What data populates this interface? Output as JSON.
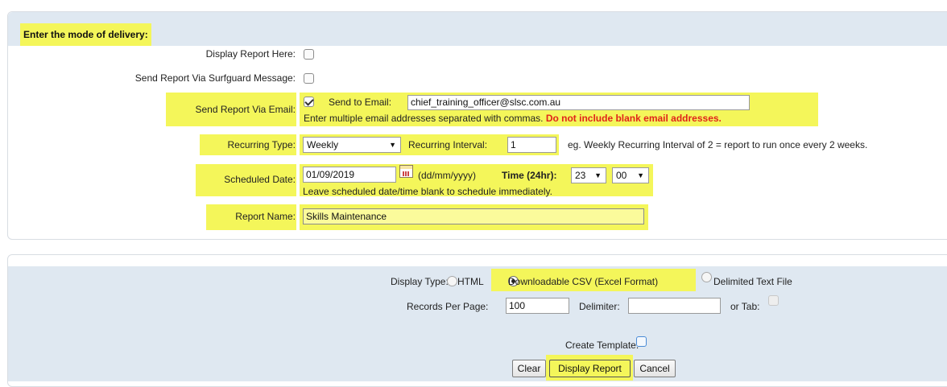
{
  "delivery": {
    "section_title": "Enter the mode of delivery:",
    "display_here_label": "Display Report Here:",
    "send_surfguard_label": "Send Report Via Surfguard Message:",
    "send_email_label": "Send Report Via Email:",
    "send_to_email_label": "Send to Email:",
    "email_value": "chief_training_officer@slsc.com.au",
    "email_note": "Enter multiple email addresses separated with commas.",
    "email_warning": "Do not include blank email addresses.",
    "recurring_type_label": "Recurring Type:",
    "recurring_type_value": "Weekly",
    "recurring_interval_label": "Recurring Interval:",
    "recurring_interval_value": "1",
    "recurring_note": "eg. Weekly Recurring Interval of 2 = report to run once every 2 weeks.",
    "scheduled_date_label": "Scheduled Date:",
    "scheduled_date_value": "01/09/2019",
    "date_format": "(dd/mm/yyyy)",
    "time_label": "Time (24hr):",
    "hour_value": "23",
    "minute_value": "00",
    "schedule_note": "Leave scheduled date/time blank to schedule immediately.",
    "report_name_label": "Report Name:",
    "report_name_value": "Skills Maintenance"
  },
  "output": {
    "display_type_label": "Display Type:",
    "option_html": "HTML",
    "option_csv": "Downloadable CSV (Excel Format)",
    "option_delimited": "Delimited Text File",
    "records_per_page_label": "Records Per Page:",
    "records_per_page_value": "100",
    "delimiter_label": "Delimiter:",
    "delimiter_value": "",
    "or_tab_label": "or Tab:",
    "create_template_label": "Create Template:",
    "clear_button": "Clear",
    "display_report_button": "Display Report",
    "cancel_button": "Cancel"
  },
  "colors": {
    "highlight": "#f4f65a",
    "header_bg": "#dfe8f1",
    "warning": "#e0241a"
  }
}
